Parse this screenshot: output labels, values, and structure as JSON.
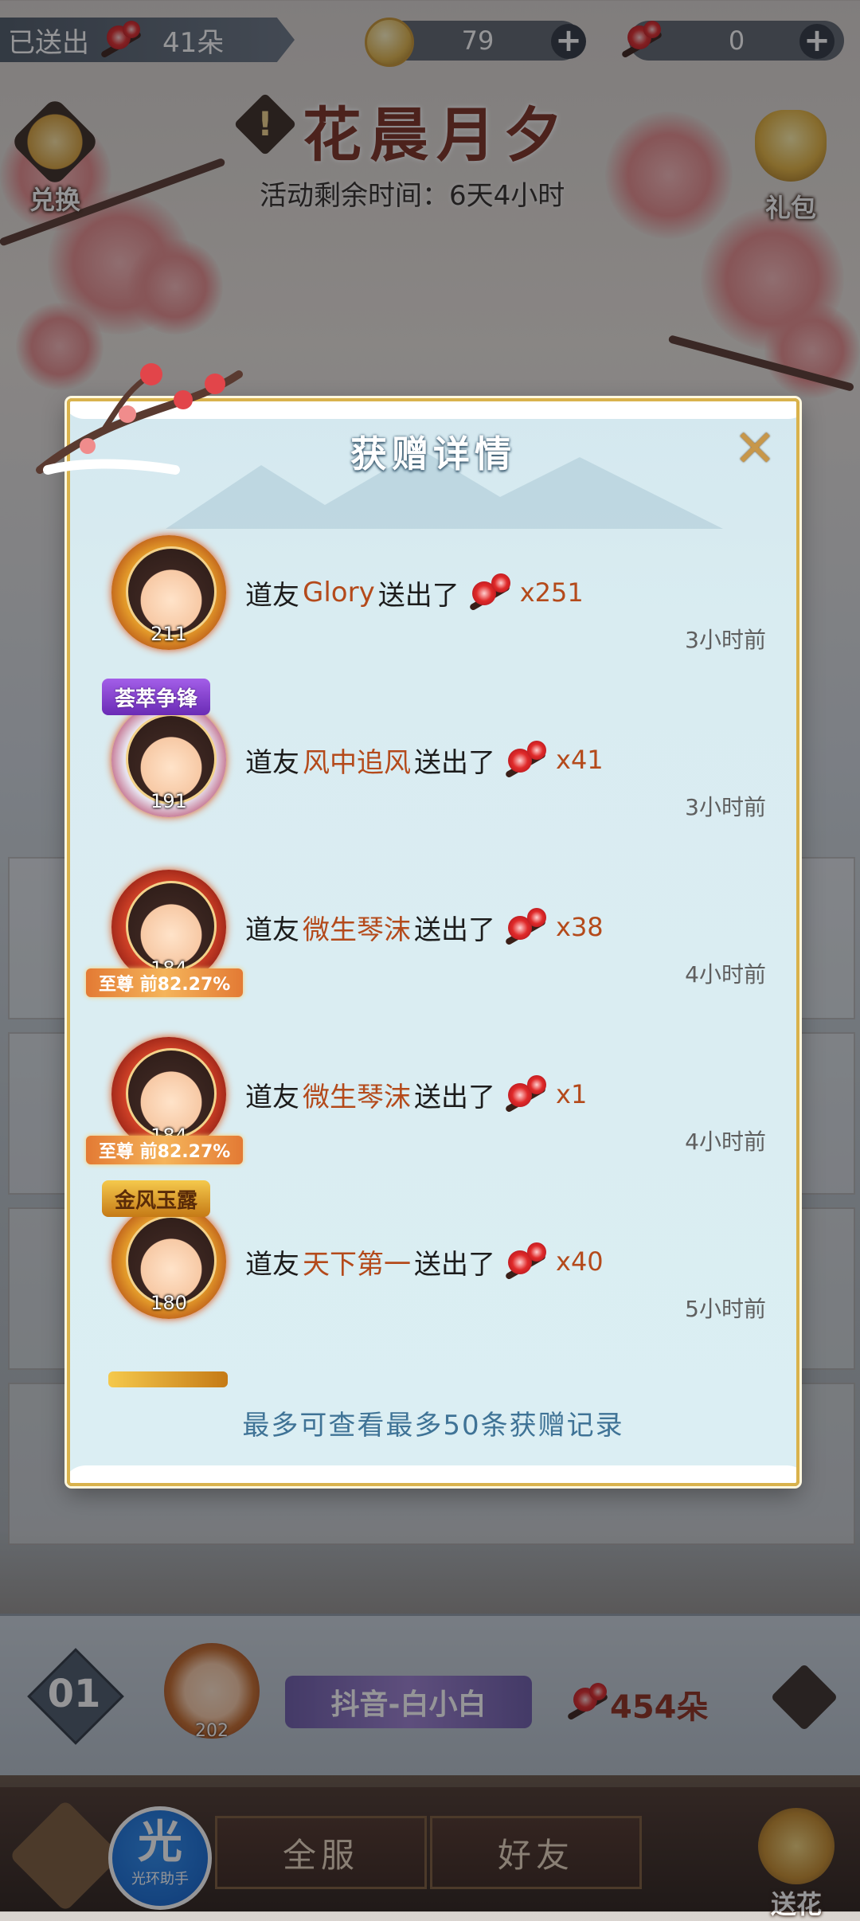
{
  "topbar": {
    "sent_label": "已送出",
    "sent_count": "41朵",
    "coins": "79",
    "flowers": "0",
    "plus": "+"
  },
  "event": {
    "title": "花晨月夕",
    "remaining": "活动剩余时间：6天4小时",
    "warn": "!"
  },
  "side_buttons": {
    "exchange": "兑换",
    "gift_pack": "礼包"
  },
  "modal": {
    "title": "获赠详情",
    "close": "✕",
    "records": [
      {
        "prefix": "道友",
        "giver": "Glory",
        "suffix": "送出了",
        "qty": "x251",
        "level": "211",
        "time": "3小时前",
        "badge": "",
        "rank_tag": ""
      },
      {
        "prefix": "道友",
        "giver": "风中追风",
        "suffix": "送出了",
        "qty": "x41",
        "level": "191",
        "time": "3小时前",
        "badge": "荟萃争锋",
        "rank_tag": ""
      },
      {
        "prefix": "道友",
        "giver": "微生琴沫",
        "suffix": "送出了",
        "qty": "x38",
        "level": "184",
        "time": "4小时前",
        "badge": "",
        "rank_tag": "至尊 前82.27%"
      },
      {
        "prefix": "道友",
        "giver": "微生琴沫",
        "suffix": "送出了",
        "qty": "x1",
        "level": "184",
        "time": "4小时前",
        "badge": "",
        "rank_tag": "至尊 前82.27%"
      },
      {
        "prefix": "道友",
        "giver": "天下第一",
        "suffix": "送出了",
        "qty": "x40",
        "level": "180",
        "time": "5小时前",
        "badge": "金风玉露",
        "rank_tag": ""
      }
    ],
    "footer_note": "最多可查看最多50条获赠记录"
  },
  "my_row": {
    "rank": "01",
    "name": "抖音-白小白",
    "flowers": "454朵",
    "level": "202"
  },
  "bottom_bar": {
    "tab_all": "全服",
    "tab_friends": "好友",
    "send_flower": "送花",
    "helper_glyph": "光",
    "helper_label": "光环助手"
  }
}
